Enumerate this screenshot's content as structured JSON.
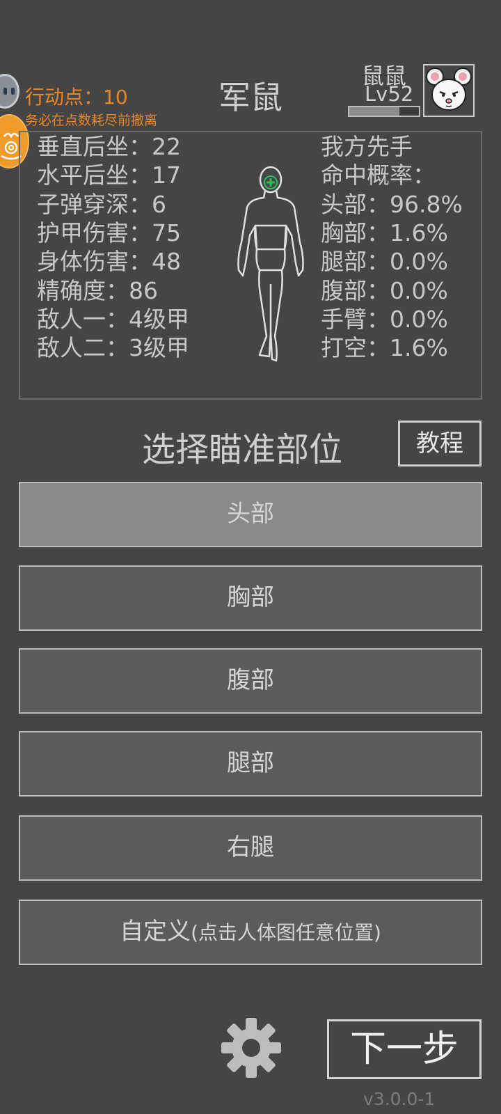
{
  "header": {
    "action_points": "行动点：10",
    "action_hint": "务必在点数耗尽前撤离",
    "enemy_name": "军鼠",
    "player_name": "鼠鼠",
    "player_level": "Lv52",
    "xp_progress": 0.72
  },
  "stats": {
    "left": [
      "垂直后坐：22",
      "水平后坐：17",
      "子弹穿深：6",
      "护甲伤害：75",
      "身体伤害：48",
      "精确度：86",
      "敌人一：4级甲",
      "敌人二：3级甲"
    ],
    "right": [
      "我方先手",
      "命中概率：",
      "头部：96.8%",
      "胸部：1.6%",
      "腿部：0.0%",
      "腹部：0.0%",
      "手臂：0.0%",
      "打空：1.6%"
    ]
  },
  "aim": {
    "title": "选择瞄准部位",
    "tutorial_label": "教程",
    "options": [
      "头部",
      "胸部",
      "腹部",
      "腿部",
      "右腿"
    ],
    "custom_main": "自定义",
    "custom_note": "(点击人体图任意位置)",
    "selected_index": 0
  },
  "footer": {
    "next_label": "下一步",
    "version": "v3.0.0-1"
  },
  "colors": {
    "background": "#454545",
    "accent_orange": "#e8862a",
    "selected_button": "#8a8a8a",
    "button": "#5b5b5b",
    "target_marker": "#2fbf5a"
  }
}
